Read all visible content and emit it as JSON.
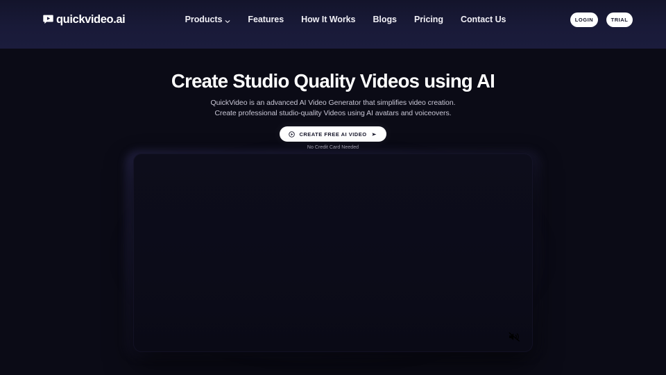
{
  "brand": {
    "logo_text": "quickvideo.ai",
    "logo_icon": "chat-play-icon"
  },
  "nav": {
    "items": [
      {
        "label": "Products",
        "has_dropdown": true,
        "icon": "chevron-down-icon"
      },
      {
        "label": "Features",
        "has_dropdown": false
      },
      {
        "label": "How It Works",
        "has_dropdown": false
      },
      {
        "label": "Blogs",
        "has_dropdown": false
      },
      {
        "label": "Pricing",
        "has_dropdown": false
      },
      {
        "label": "Contact Us",
        "has_dropdown": false
      }
    ]
  },
  "auth": {
    "login_label": "LOGIN",
    "trial_label": "TRIAL"
  },
  "hero": {
    "title": "Create Studio Quality Videos using AI",
    "subtitle_line1": "QuickVideo is an advanced AI Video Generator that simplifies video creation.",
    "subtitle_line2": "Create professional studio-quality Videos using AI avatars and voiceovers.",
    "cta_label": "CREATE FREE AI VIDEO",
    "cta_icon_left": "record-circle-icon",
    "cta_icon_right": "play-arrow-icon",
    "cta_note": "No Credit Card Needed"
  },
  "video": {
    "mute_icon": "speaker-muted-icon",
    "muted": true
  },
  "colors": {
    "page_background": "#0b0b16",
    "header_background": "#191a38",
    "text_primary": "#ffffff",
    "text_secondary": "#c9c7d6",
    "button_background": "#ffffff",
    "button_text": "#131327"
  }
}
